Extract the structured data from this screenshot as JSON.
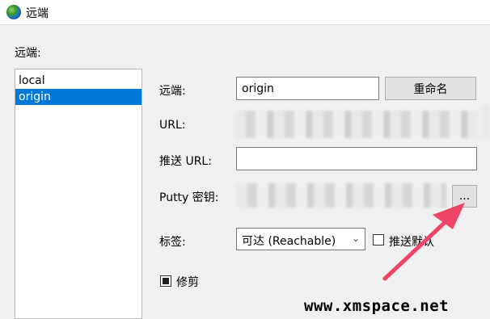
{
  "window": {
    "title": "远端"
  },
  "remotes_label": "远端:",
  "remotes": [
    {
      "name": "local",
      "selected": false
    },
    {
      "name": "origin",
      "selected": true
    }
  ],
  "form": {
    "remote_label": "远端:",
    "remote_value": "origin",
    "rename_button": "重命名",
    "url_label": "URL:",
    "push_url_label": "推送 URL:",
    "push_url_value": "",
    "putty_label": "Putty 密钥:",
    "browse_button": "...",
    "tags_label": "标签:",
    "tags_value": "可达 (Reachable)",
    "push_default_label": "推送默认",
    "prune_label": "修剪"
  },
  "watermark": "www.xmspace.net",
  "colors": {
    "accent": "#0078d7",
    "arrow": "#ee4466"
  }
}
